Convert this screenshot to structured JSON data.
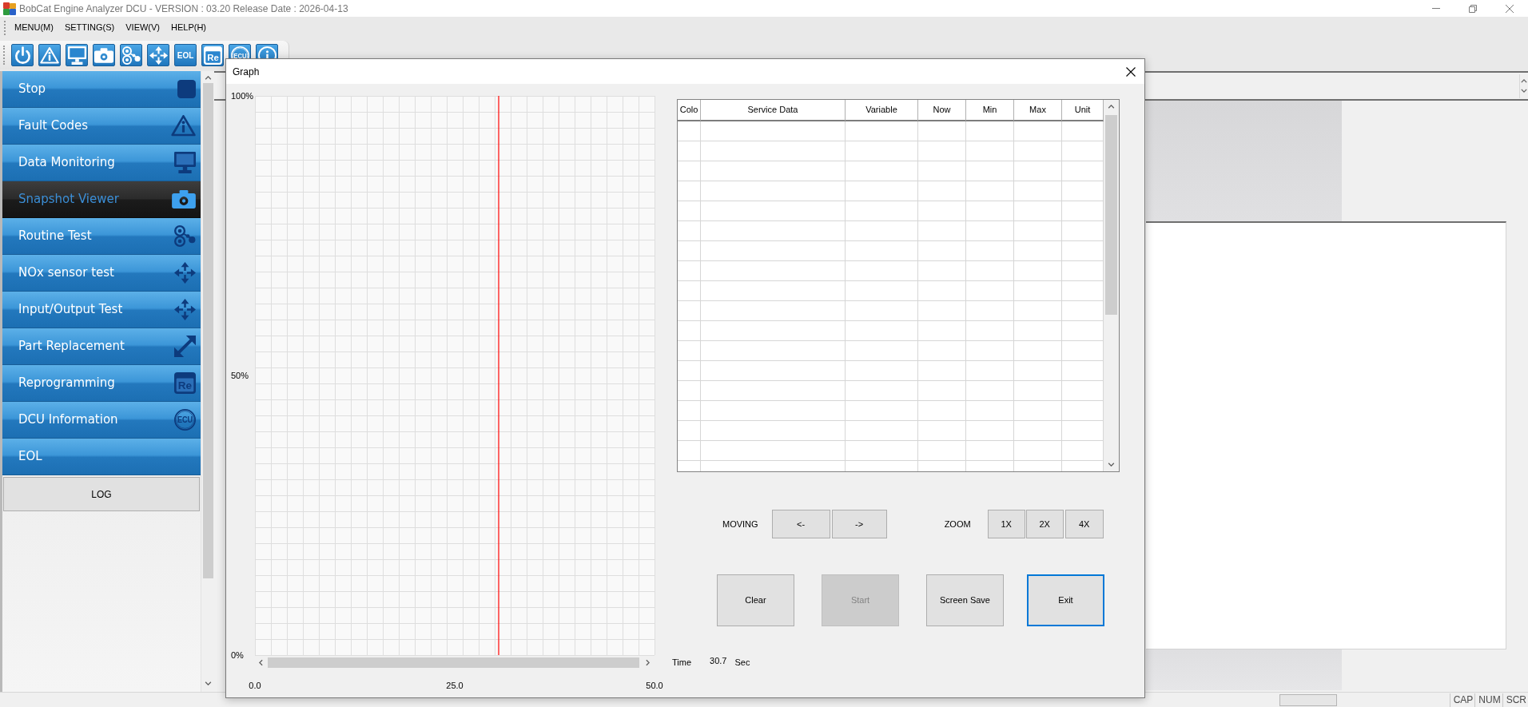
{
  "window": {
    "title": "BobCat Engine Analyzer DCU - VERSION : 03.20 Release Date : 2026-04-13"
  },
  "menu": [
    "MENU(M)",
    "SETTING(S)",
    "VIEW(V)",
    "HELP(H)"
  ],
  "toolbar": [
    {
      "kind": "power"
    },
    {
      "kind": "warning"
    },
    {
      "kind": "monitor"
    },
    {
      "kind": "camera"
    },
    {
      "kind": "routine"
    },
    {
      "kind": "arrows"
    },
    {
      "kind": "eol",
      "label": "EOL"
    },
    {
      "kind": "file",
      "label": "Re"
    },
    {
      "kind": "ecu",
      "label": "ECU"
    },
    {
      "kind": "info"
    }
  ],
  "sidebar": {
    "items": [
      {
        "label": "Stop",
        "kind": "stop",
        "selected": false
      },
      {
        "label": "Fault Codes",
        "kind": "warning",
        "selected": false
      },
      {
        "label": "Data Monitoring",
        "kind": "monitor",
        "selected": false
      },
      {
        "label": "Snapshot Viewer",
        "kind": "camera",
        "selected": true
      },
      {
        "label": "Routine Test",
        "kind": "routine",
        "selected": false
      },
      {
        "label": "NOx sensor test",
        "kind": "arrows",
        "selected": false
      },
      {
        "label": "Input/Output Test",
        "kind": "arrows",
        "selected": false
      },
      {
        "label": "Part Replacement",
        "kind": "swap",
        "selected": false
      },
      {
        "label": "Reprogramming",
        "kind": "file",
        "icon_text": "Re",
        "selected": false
      },
      {
        "label": "DCU Information",
        "kind": "ecu",
        "icon_text": "ECU",
        "selected": false
      },
      {
        "label": "EOL",
        "kind": "none",
        "selected": false
      }
    ],
    "log_button": "LOG"
  },
  "graph_dialog": {
    "title": "Graph",
    "chart_data": {
      "type": "line",
      "xlim": [
        0,
        50
      ],
      "ylim": [
        0,
        100
      ],
      "xticks": [
        {
          "value": 0,
          "label": "0.0"
        },
        {
          "value": 25,
          "label": "25.0"
        },
        {
          "value": 50,
          "label": "50.0"
        }
      ],
      "yticks": [
        {
          "value": 100,
          "label": "100%"
        },
        {
          "value": 50,
          "label": "50%"
        },
        {
          "value": 0,
          "label": "0%"
        }
      ],
      "ref_lines": [
        {
          "axis": "x",
          "value": 30.5
        }
      ]
    },
    "table": {
      "columns": [
        "Colo",
        "Service Data",
        "Variable",
        "Now",
        "Min",
        "Max",
        "Unit"
      ]
    },
    "moving": {
      "label": "MOVING",
      "buttons": [
        "<-",
        "->"
      ]
    },
    "zoom": {
      "label": "ZOOM",
      "buttons": [
        "1X",
        "2X",
        "4X"
      ]
    },
    "actions": [
      {
        "label": "Clear",
        "disabled": false,
        "focused": false
      },
      {
        "label": "Start",
        "disabled": true,
        "focused": false
      },
      {
        "label": "Screen Save",
        "disabled": false,
        "focused": false
      },
      {
        "label": "Exit",
        "disabled": false,
        "focused": true
      }
    ],
    "time": {
      "label": "Time",
      "value": "30.7",
      "unit": "Sec"
    }
  },
  "status_bar": {
    "indicators": [
      "CAP",
      "NUM",
      "SCR"
    ]
  }
}
